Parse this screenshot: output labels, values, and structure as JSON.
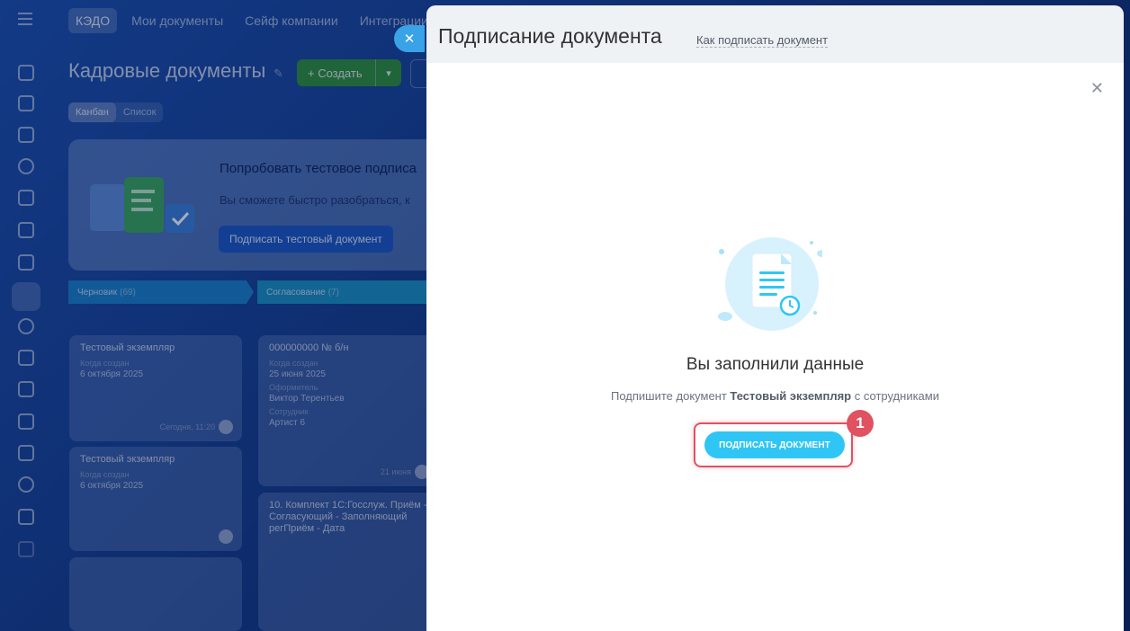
{
  "topnav": {
    "items": [
      "КЭДО",
      "Мои документы",
      "Сейф компании",
      "Интеграции"
    ]
  },
  "page": {
    "title": "Кадровые документы",
    "create_label": "+ Создать"
  },
  "views": [
    "Канбан",
    "Список"
  ],
  "promo": {
    "title": "Попробовать тестовое подписа",
    "text": "Вы сможете быстро разобраться, к",
    "button": "Подписать тестовый документ"
  },
  "columns": [
    {
      "name": "Черновик",
      "count": "(69)"
    },
    {
      "name": "Согласование",
      "count": "(7)"
    }
  ],
  "cards": [
    {
      "title": "Тестовый экземпляр",
      "key": "Когда создан",
      "value": "6 октября 2025",
      "who": "Сегодня, 11:20"
    },
    {
      "title": "Тестовый экземпляр",
      "key": "Когда создан",
      "value": "6 октября 2025"
    },
    {
      "title": "000000000 № б/н",
      "key": "Когда создан",
      "value": "25 июня 2025",
      "key2": "Оформитель",
      "value2": "Виктор Терентьев",
      "key3": "Сотрудник",
      "value3": "Артист 6",
      "who": "21 июня"
    },
    {
      "title": "10. Комплект 1С:Госслуж. Приём - Согласующий - Заполняющий регПриём - Дата"
    }
  ],
  "panel": {
    "title": "Подписание документа",
    "help_link": "Как подписать документ",
    "message_title": "Вы заполнили данные",
    "message_prefix": "Подпишите документ ",
    "document_name": "Тестовый экземпляр",
    "message_suffix": " с сотрудниками",
    "sign_button": "ПОДПИСАТЬ ДОКУМЕНТ",
    "step_number": "1"
  },
  "colors": {
    "accent": "#2fc6f6",
    "highlight": "#e05260",
    "create": "#2e8f3a"
  }
}
